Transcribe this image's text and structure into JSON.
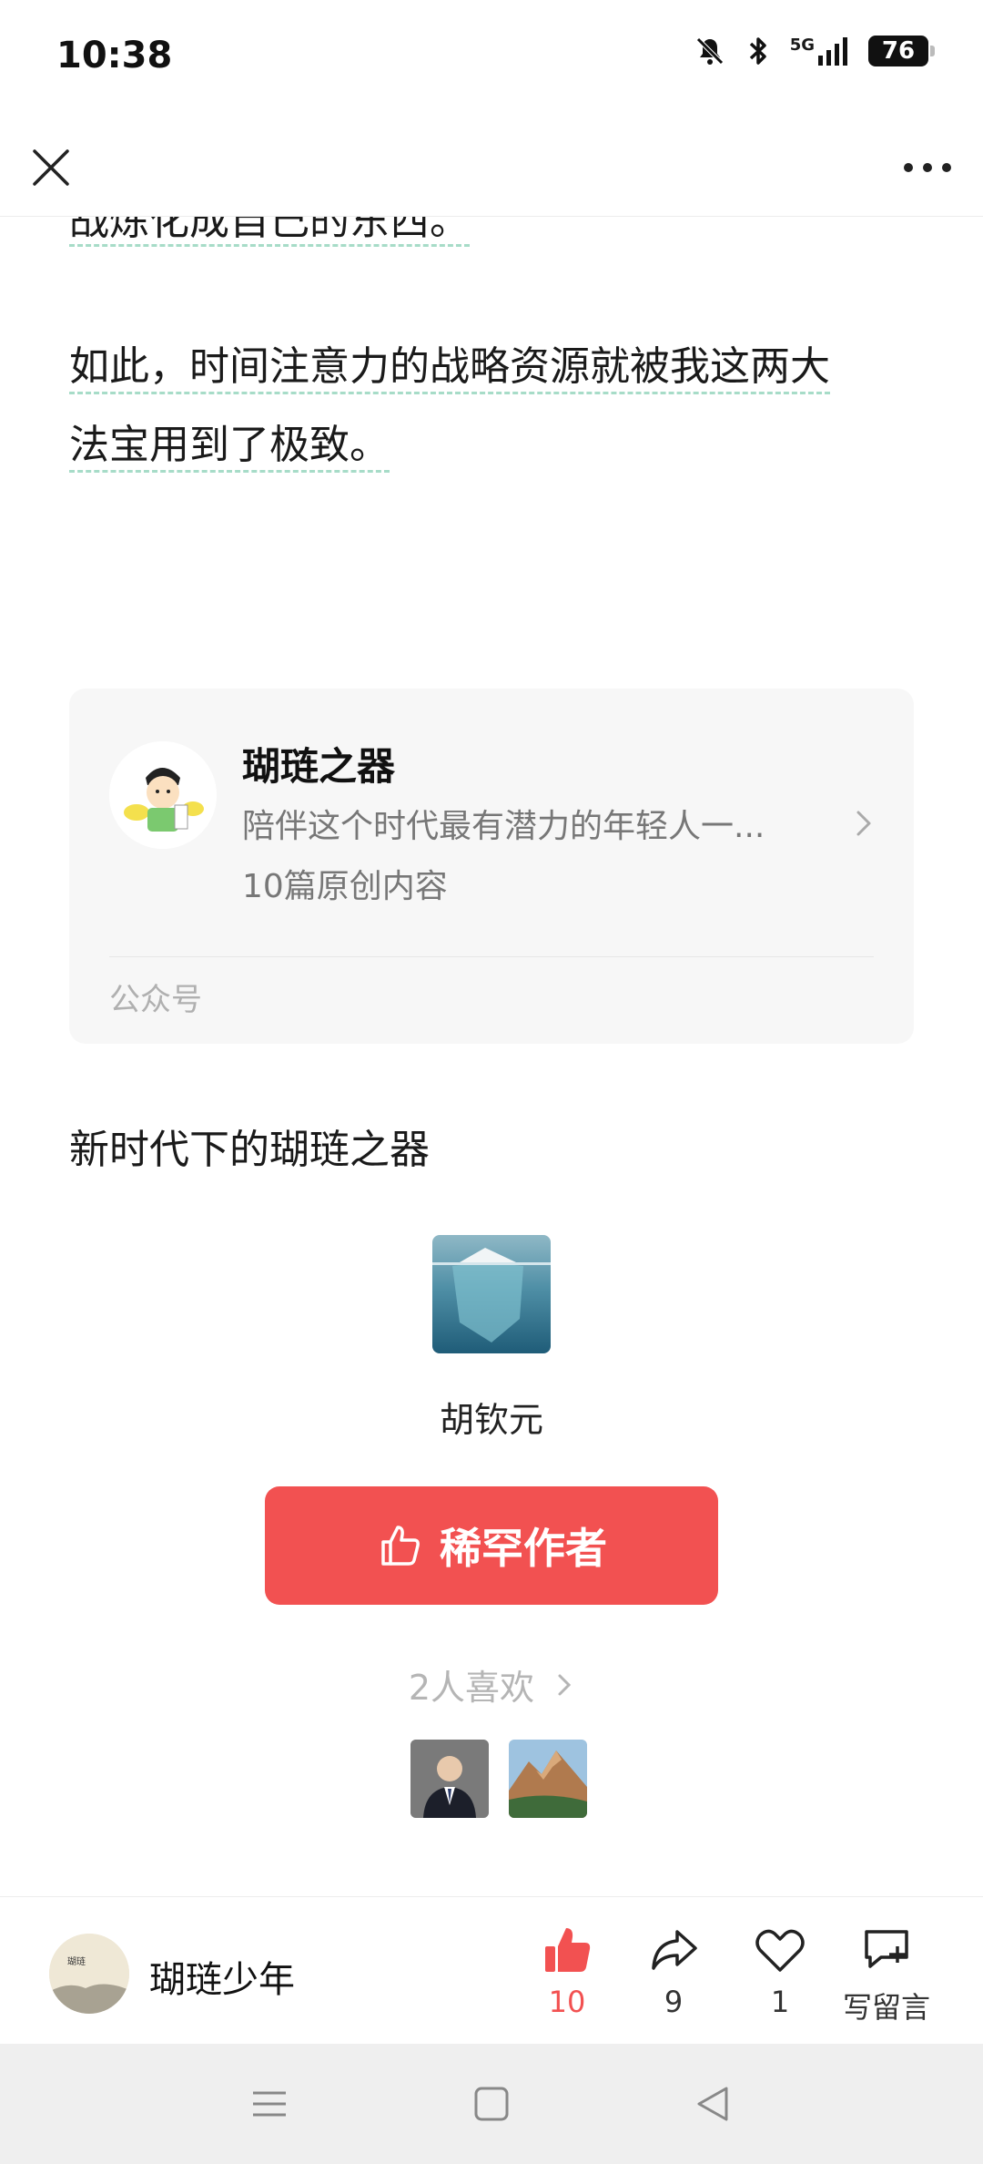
{
  "status_bar": {
    "time": "10:38",
    "network": "5G",
    "battery": "76",
    "icons": [
      "bell-muted-icon",
      "bluetooth-icon",
      "signal-icon",
      "battery-icon"
    ]
  },
  "header": {
    "close_icon": "close-icon",
    "more_icon": "more-icon"
  },
  "article": {
    "cut_line": "战炼化成自己的东西。",
    "paragraph_line_1": "如此，时间注意力的战略资源就被我这两大",
    "paragraph_line_2": "法宝用到了极致。"
  },
  "account_card": {
    "name": "瑚琏之器",
    "description": "陪伴这个时代最有潜力的年轻人一...",
    "content_count": "10篇原创内容",
    "type": "公众号"
  },
  "collection_title": "新时代下的瑚琏之器",
  "author": {
    "name": "胡钦元"
  },
  "reward_button": {
    "label": "稀罕作者"
  },
  "likes": {
    "label": "2人喜欢",
    "count": 2
  },
  "bottom_bar": {
    "writer_name": "瑚琏少年",
    "like_count": "10",
    "share_count": "9",
    "favorite_count": "1",
    "comment_label": "写留言"
  },
  "colors": {
    "accent_red": "#f25151",
    "underline_green": "#a7dcc8",
    "muted_gray": "#b5b5b5"
  }
}
